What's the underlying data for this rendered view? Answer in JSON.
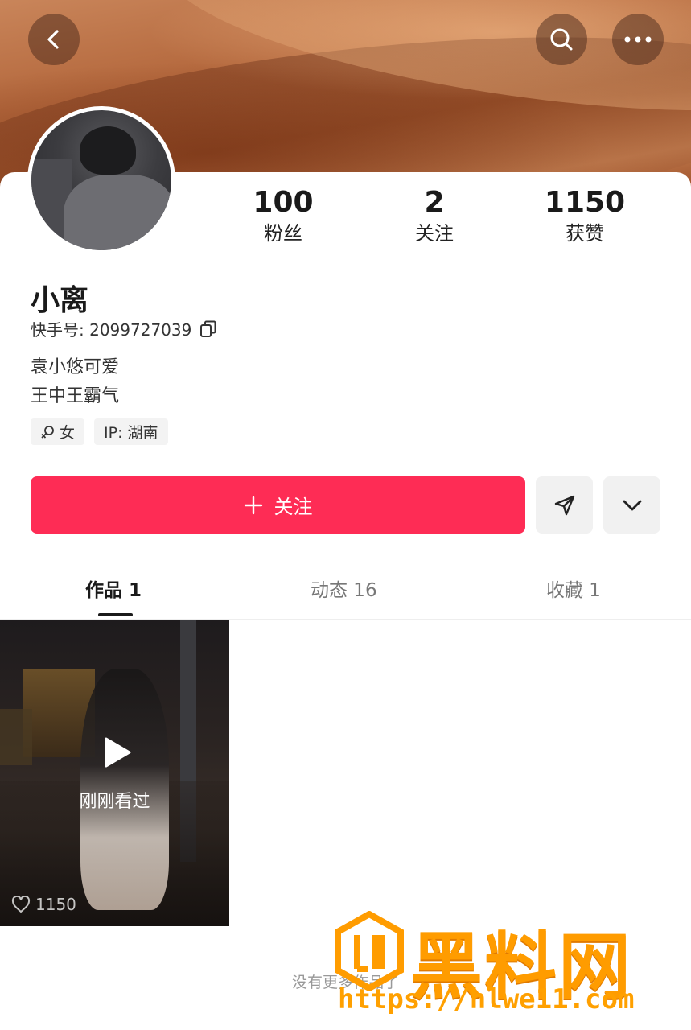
{
  "header": {
    "back_icon": "chevron-left-icon",
    "search_icon": "search-icon",
    "more_icon": "more-dots-icon"
  },
  "stats": [
    {
      "value": "100",
      "label": "粉丝"
    },
    {
      "value": "2",
      "label": "关注"
    },
    {
      "value": "1150",
      "label": "获赞"
    }
  ],
  "profile": {
    "name": "小离",
    "kuaishou_id": "快手号: 2099727039",
    "bio_line1": "袁小悠可爱",
    "bio_line2": "王中王霸气",
    "tag_gender": "女",
    "tag_ip": "IP: 湖南"
  },
  "actions": {
    "follow_label": "关注"
  },
  "tabs": [
    {
      "label": "作品 1",
      "active": true
    },
    {
      "label": "动态 16",
      "active": false
    },
    {
      "label": "收藏 1",
      "active": false
    }
  ],
  "works": [
    {
      "overlay": "刚刚看过",
      "likes": "1150"
    }
  ],
  "footer": {
    "no_more": "没有更多作品了"
  },
  "watermark": {
    "brand": "黑料网",
    "url": "https://hlwe11.com"
  },
  "colors": {
    "accent": "#fe2c55",
    "watermark": "#ff9c00"
  }
}
